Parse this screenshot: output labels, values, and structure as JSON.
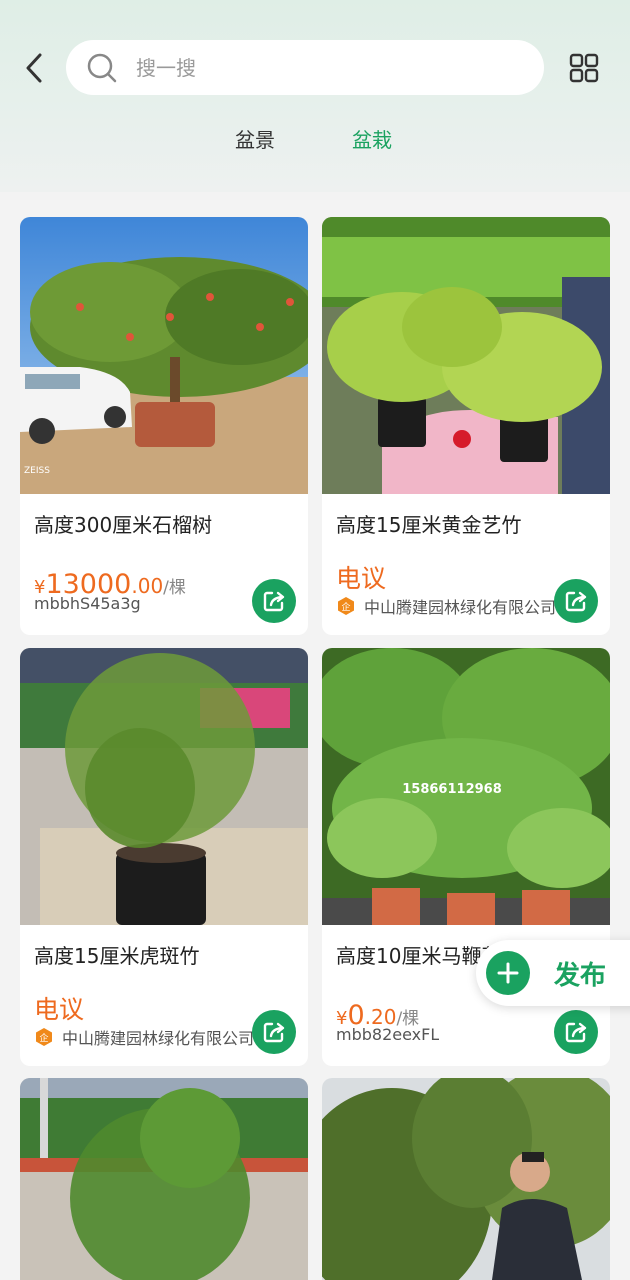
{
  "search": {
    "placeholder": "搜一搜"
  },
  "tabs": [
    {
      "label": "盆景",
      "active": false
    },
    {
      "label": "盆栽",
      "active": true
    }
  ],
  "products": [
    {
      "title": "高度300厘米石榴树",
      "price_currency": "¥",
      "price_int": "13000",
      "price_dec": ".00",
      "price_unit": "/棵",
      "seller": "mbbhS45a3g",
      "seller_badge": false,
      "image": "pomegranate-tree-photo",
      "watermark": "ZEISS"
    },
    {
      "title": "高度15厘米黄金艺竹",
      "price_text": "电议",
      "seller": "中山腾建园林绿化有限公司",
      "seller_badge": true,
      "image": "golden-bamboo-pots-photo"
    },
    {
      "title": "高度15厘米虎斑竹",
      "price_text": "电议",
      "seller": "中山腾建园林绿化有限公司",
      "seller_badge": true,
      "image": "tiger-bamboo-pot-photo"
    },
    {
      "title": "高度10厘米马鞭草",
      "price_currency": "¥",
      "price_int": "0",
      "price_dec": ".20",
      "price_unit": "/棵",
      "seller": "mbb82eexFL",
      "seller_badge": false,
      "image": "verbena-seedlings-photo",
      "watermark": "15866112968"
    },
    {
      "title": "",
      "image": "bamboo-nursery-photo"
    },
    {
      "title": "",
      "image": "man-with-trees-photo"
    }
  ],
  "fab": {
    "label": "发布"
  },
  "colors": {
    "accent": "#1aa260",
    "price": "#ee6a1f",
    "background": "#f3f3f3"
  },
  "icons": [
    "back-arrow-icon",
    "search-icon",
    "grid-icon",
    "share-icon",
    "plus-icon",
    "company-badge-icon"
  ]
}
